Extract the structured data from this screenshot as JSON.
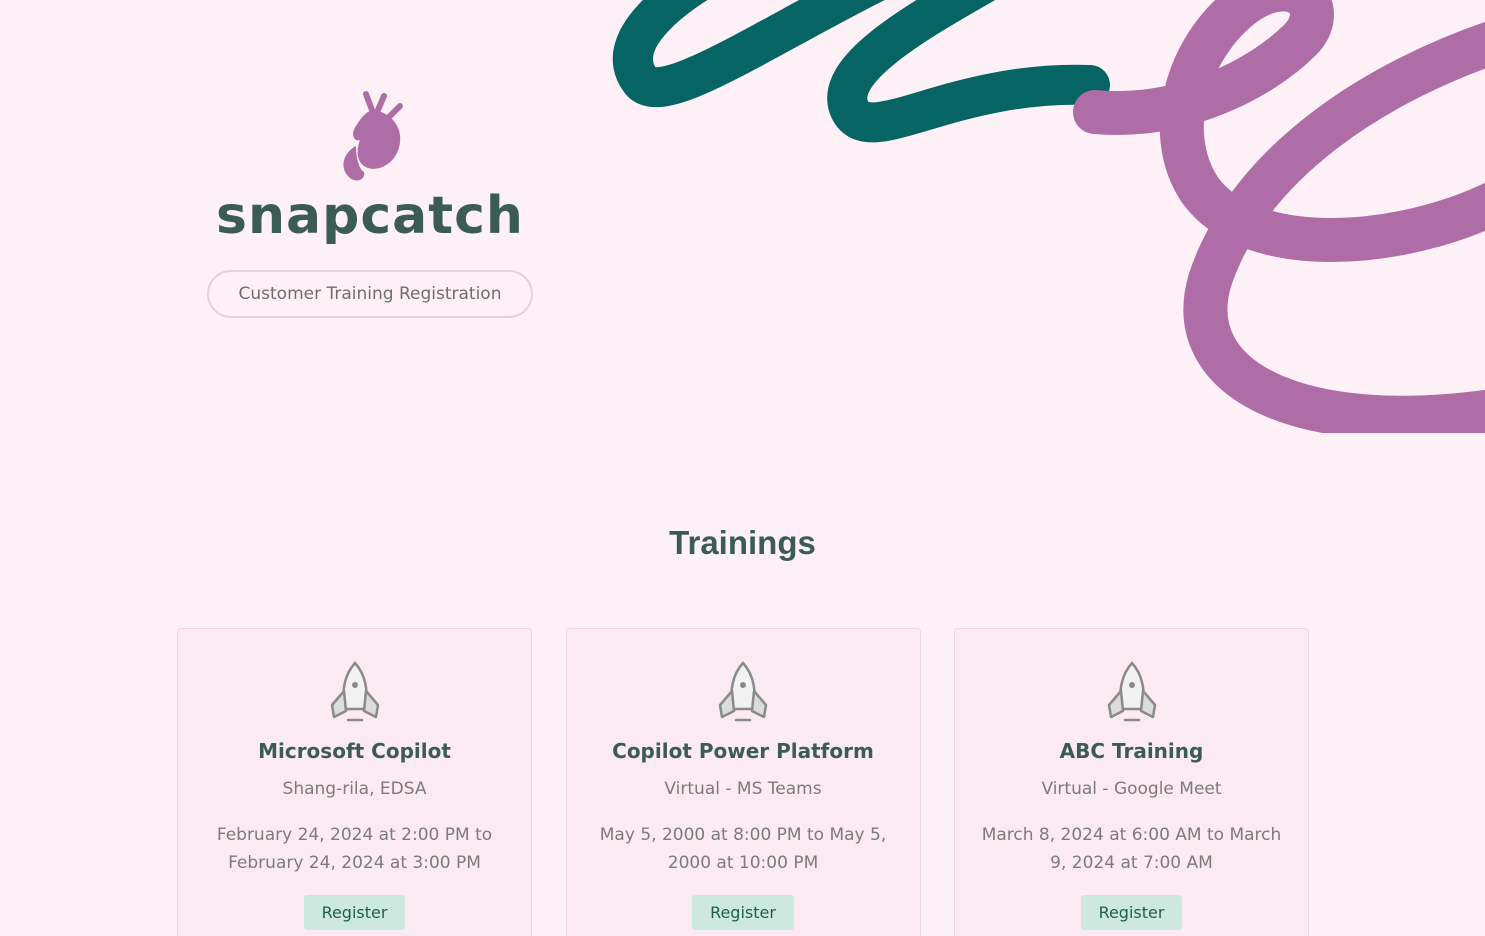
{
  "brand": {
    "name": "snapcatch",
    "logo_icon": "butterfly-hand-icon",
    "tagline_button": "Customer Training Registration"
  },
  "colors": {
    "background": "#fdf0f6",
    "primary_text": "#3a5c55",
    "accent_teal": "#066564",
    "accent_purple": "#af6da8",
    "register_bg": "#cde8df"
  },
  "trainings": {
    "heading": "Trainings",
    "cards": [
      {
        "icon": "rocket-icon",
        "title": "Microsoft Copilot",
        "location": "Shang-rila, EDSA",
        "dates": "February 24, 2024 at 2:00 PM to February 24, 2024 at 3:00 PM",
        "button": "Register"
      },
      {
        "icon": "rocket-icon",
        "title": "Copilot Power Platform",
        "location": "Virtual - MS Teams",
        "dates": "May 5, 2000 at 8:00 PM to May 5, 2000 at 10:00 PM",
        "button": "Register"
      },
      {
        "icon": "rocket-icon",
        "title": "ABC Training",
        "location": "Virtual - Google Meet",
        "dates": "March 8, 2024 at 6:00 AM to March 9, 2024 at 7:00 AM",
        "button": "Register"
      }
    ]
  }
}
